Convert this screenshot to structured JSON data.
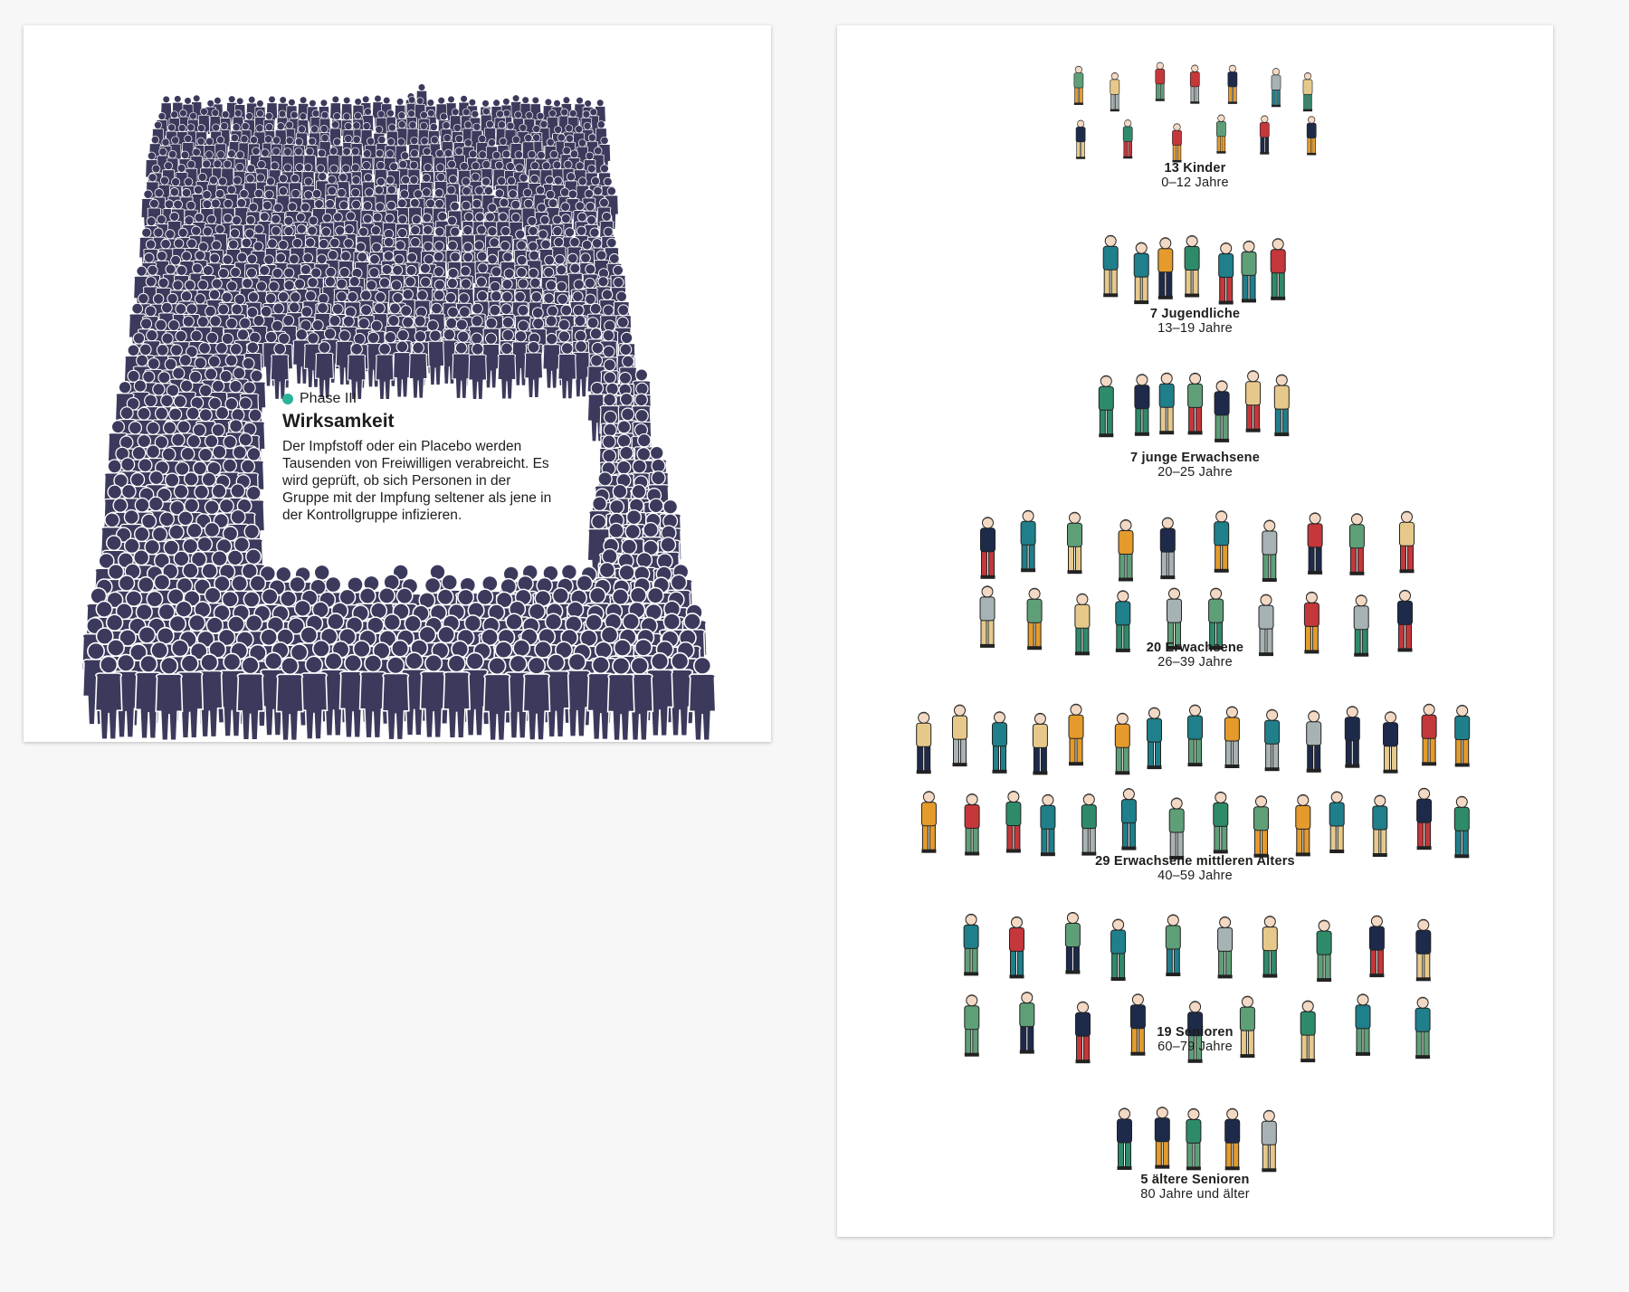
{
  "crowd_panel": {
    "phase_label": "Phase III",
    "title": "Wirksamkeit",
    "body": "Der Impfstoff oder ein Placebo werden Tausenden von Freiwilligen verabreicht. Es wird geprüft, ob sich Personen in der Gruppe mit der Impfung seltener als jene in der Kontrollgruppe infizieren.",
    "colors": {
      "crowd": "#3c3a5c",
      "accent_dot": "#2bb39a"
    }
  },
  "age_groups": [
    {
      "count_label": "13 Kinder",
      "range_label": "0–12 Jahre",
      "people": 13
    },
    {
      "count_label": "7 Jugendliche",
      "range_label": "13–19 Jahre",
      "people": 7
    },
    {
      "count_label": "7 junge Erwachsene",
      "range_label": "20–25 Jahre",
      "people": 7
    },
    {
      "count_label": "20 Erwachsene",
      "range_label": "26–39 Jahre",
      "people": 20
    },
    {
      "count_label": "29 Erwachsene mittleren Alters",
      "range_label": "40–59 Jahre",
      "people": 29
    },
    {
      "count_label": "19 Senioren",
      "range_label": "60–79 Jahre",
      "people": 19
    },
    {
      "count_label": "5 ältere Senioren",
      "range_label": "80 Jahre und älter",
      "people": 5
    }
  ],
  "palette": [
    "#1f7f8a",
    "#5e9f78",
    "#c4373a",
    "#e49b2b",
    "#a7b2b4",
    "#1d2a4a",
    "#e6c98a",
    "#2e8b6a"
  ]
}
